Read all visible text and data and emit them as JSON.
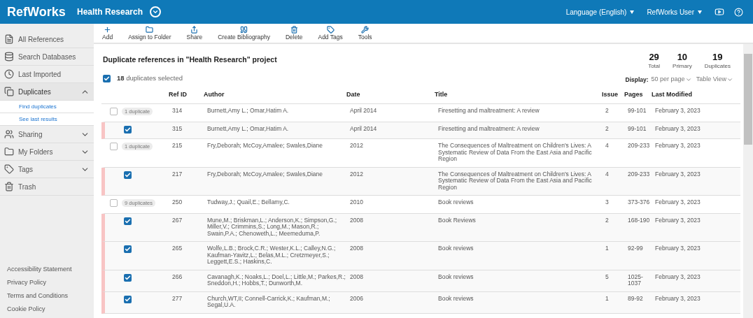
{
  "header": {
    "logo": "RefWorks",
    "project": "Health Research",
    "language": "Language (English)",
    "user": "RefWorks User"
  },
  "sidebar": {
    "items": [
      {
        "label": "All References",
        "selected": false
      },
      {
        "label": "Search Databases",
        "selected": false
      },
      {
        "label": "Last Imported",
        "selected": false
      },
      {
        "label": "Duplicates",
        "selected": true,
        "expanded": true,
        "children": [
          {
            "label": "Find duplicates"
          },
          {
            "label": "See last results"
          }
        ]
      },
      {
        "label": "Sharing",
        "selected": false,
        "expanded": false
      },
      {
        "label": "My Folders",
        "selected": false,
        "expanded": false
      },
      {
        "label": "Tags",
        "selected": false,
        "expanded": false
      },
      {
        "label": "Trash",
        "selected": false
      }
    ],
    "footer_links": [
      "Accessibility Statement",
      "Privacy Policy",
      "Terms and Conditions",
      "Cookie Policy"
    ]
  },
  "toolbar": [
    {
      "label": "Add"
    },
    {
      "label": "Assign to Folder"
    },
    {
      "label": "Share"
    },
    {
      "label": "Create Bibliography"
    },
    {
      "label": "Delete"
    },
    {
      "label": "Add Tags"
    },
    {
      "label": "Tools"
    }
  ],
  "heading": "Duplicate references in \"Health Research\" project",
  "stats": [
    {
      "value": "29",
      "label": "Total"
    },
    {
      "value": "10",
      "label": "Primary"
    },
    {
      "value": "19",
      "label": "Duplicates"
    }
  ],
  "select_all": {
    "checked": true,
    "text": "**18** duplicates selected"
  },
  "display": {
    "label": "Display:",
    "per_page": "50 per page",
    "view": "Table View"
  },
  "table": {
    "columns": [
      "Ref ID",
      "Author",
      "Date",
      "Title",
      "Issue",
      "Pages",
      "Last Modified"
    ],
    "rows": [
      {
        "kind": "primary",
        "checked": false,
        "badge": "1 duplicate",
        "ref_id": "314",
        "author": "Burnett,Amy L.; Omar,Hatim A.",
        "date": "April 2014",
        "title": "Firesetting and maltreatment: A review",
        "issue": "2",
        "pages": "99-101",
        "modified": "February 3, 2023"
      },
      {
        "kind": "duplicate",
        "checked": true,
        "ref_id": "315",
        "author": "Burnett,Amy L.; Omar,Hatim A.",
        "date": "April 2014",
        "title": "Firesetting and maltreatment: A review",
        "issue": "2",
        "pages": "99-101",
        "modified": "February 3, 2023"
      },
      {
        "kind": "primary",
        "checked": false,
        "badge": "1 duplicate",
        "ref_id": "215",
        "author": "Fry,Deborah; McCoy,Amalee; Swales,Diane",
        "date": "2012",
        "title": "The Consequences of Maltreatment on Children's Lives: A Systematic Review of Data From the East Asia and Pacific Region",
        "issue": "4",
        "pages": "209-233",
        "modified": "February 3, 2023"
      },
      {
        "kind": "duplicate",
        "checked": true,
        "ref_id": "217",
        "author": "Fry,Deborah; McCoy,Amalee; Swales,Diane",
        "date": "2012",
        "title": "The Consequences of Maltreatment on Children's Lives: A Systematic Review of Data From the East Asia and Pacific Region",
        "issue": "4",
        "pages": "209-233",
        "modified": "February 3, 2023"
      },
      {
        "kind": "primary",
        "checked": false,
        "badge": "9 duplicates",
        "ref_id": "250",
        "author": "Tudway,J.; Quail,E.; Bellamy,C.",
        "date": "2010",
        "title": "Book reviews",
        "issue": "3",
        "pages": "373-376",
        "modified": "February 3, 2023"
      },
      {
        "kind": "duplicate",
        "checked": true,
        "ref_id": "267",
        "author": "Mune,M.; Briskman,L.; Anderson,K.; Simpson,G.; Miller,V.; Crimmins,S.; Long,M.; Mason,R.; Swain,P.A.; Chenoweth,L.; Meemeduma,P.",
        "date": "2008",
        "title": "Book Reviews",
        "issue": "2",
        "pages": "168-190",
        "modified": "February 3, 2023"
      },
      {
        "kind": "duplicate",
        "checked": true,
        "ref_id": "265",
        "author": "Wolfe,L.B.; Brock,C.R.; Wester,K.L.; Calley,N.G.; Kaufman-Yavitz,L.; Belas,M.L.; Cretzmeyer,S.; Leggett,E.S.; Haskins,C.",
        "date": "2008",
        "title": "Book reviews",
        "issue": "1",
        "pages": "92-99",
        "modified": "February 3, 2023"
      },
      {
        "kind": "duplicate",
        "checked": true,
        "ref_id": "266",
        "author": "Cavanagh,K.; Noaks,L.; Doel,L.; Little,M.; Parkes,R.; Sneddon,H.; Hobbs,T.; Dunworth,M.",
        "date": "2008",
        "title": "Book reviews",
        "issue": "5",
        "pages": "1025-1037",
        "modified": "February 3, 2023"
      },
      {
        "kind": "duplicate",
        "checked": true,
        "ref_id": "277",
        "author": "Church,WT,II; Connell-Carrick,K.; Kaufman,M.; Segal,U.A.",
        "date": "2006",
        "title": "Book reviews",
        "issue": "1",
        "pages": "89-92",
        "modified": "February 3, 2023"
      }
    ]
  }
}
